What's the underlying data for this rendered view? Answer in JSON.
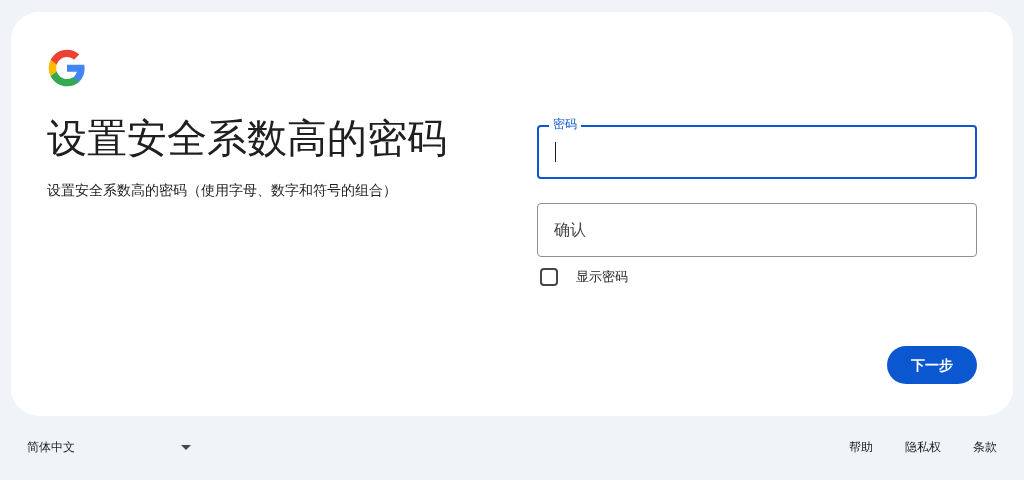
{
  "heading": "设置安全系数高的密码",
  "subheading": "设置安全系数高的密码（使用字母、数字和符号的组合）",
  "fields": [
    {
      "label": "密码",
      "focused": true
    },
    {
      "placeholder": "确认",
      "focused": false
    }
  ],
  "show_password": {
    "label": "显示密码",
    "checked": false
  },
  "next_button": "下一步",
  "footer": {
    "language": "简体中文",
    "links": [
      "帮助",
      "隐私权",
      "条款"
    ]
  }
}
